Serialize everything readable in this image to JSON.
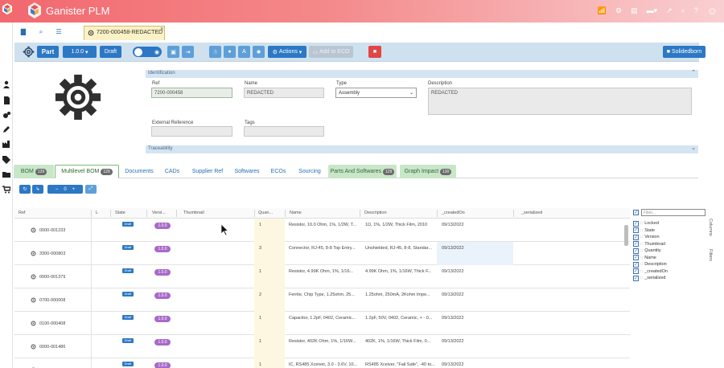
{
  "app": {
    "title": "Ganister PLM"
  },
  "tab": {
    "label": "7200-000458-REDACTED",
    "close": "x"
  },
  "toolbar": {
    "type_label": "Part",
    "version": "1.0.0",
    "status": "Draft",
    "actions_label": "Actions",
    "add_to_eco_label": "Add to ECO",
    "solidedborn_label": "Solidedborn"
  },
  "identification": {
    "title": "Identification",
    "ref_label": "Ref",
    "ref_value": "7200-000458",
    "name_label": "Name",
    "name_value": "REDACTED",
    "type_label": "Type",
    "type_value": "Assembly",
    "description_label": "Description",
    "description_value": "REDACTED",
    "external_ref_label": "External Reference",
    "tags_label": "Tags"
  },
  "traceability": {
    "title": "Traceability"
  },
  "bottom_tabs": [
    {
      "label": "BOM",
      "badge": "129"
    },
    {
      "label": "Multilevel BOM",
      "badge": "129"
    },
    {
      "label": "Documents"
    },
    {
      "label": "CADs"
    },
    {
      "label": "Supplier Ref"
    },
    {
      "label": "Softwares"
    },
    {
      "label": "ECOs"
    },
    {
      "label": "Sourcing"
    },
    {
      "label": "Parts And Softwares",
      "badge": "129"
    },
    {
      "label": "Graph Impact",
      "badge": "130"
    }
  ],
  "subtoolbar": {
    "counter": "0"
  },
  "grid": {
    "columns": [
      "Ref",
      "L",
      "State",
      "Versi...",
      "Thumbnail",
      "Quan...",
      "Name",
      "Description",
      "_createdOn",
      "_serialized"
    ],
    "rows": [
      {
        "ref": "0000-001233",
        "state": "Draft",
        "version": "1.0.0",
        "qty": "1",
        "name": "Resistor, 10.0 Ohm, 1%, 1/2W, T...",
        "description": "1Ω, 1%, 1/2W, Thick Film, 2010",
        "created": "09/13/2022"
      },
      {
        "ref": "3300-000803",
        "state": "Draft",
        "version": "1.0.0",
        "qty": "3",
        "name": "Connector, RJ-45, 8-8 Top Entry...",
        "description": "Unshielded, RJ-45, 8-8, Standar...",
        "created": "09/13/2022"
      },
      {
        "ref": "0000-001379",
        "state": "Draft",
        "version": "1.0.0",
        "qty": "1",
        "name": "Resistor, 4.99K Ohm, 1%, 1/16...",
        "description": "4.99K Ohm, 1%, 1/16W, Thick F...",
        "created": "09/13/2022"
      },
      {
        "ref": "0700-000008",
        "state": "Draft",
        "version": "1.0.0",
        "qty": "2",
        "name": "Ferrite, Chip Type, 1.25ohm, 25...",
        "description": "1.25ohm, 250mA, 2Kohm Impe...",
        "created": "09/13/2022"
      },
      {
        "ref": "0100-000408",
        "state": "Draft",
        "version": "1.0.0",
        "qty": "1",
        "name": "Capacitor, 1.2pF, 0402, Ceramic...",
        "description": "1.2pF, 50V, 0402, Ceramic, + - 0...",
        "created": "09/13/2022"
      },
      {
        "ref": "0000-001486",
        "state": "Draft",
        "version": "1.0.0",
        "qty": "1",
        "name": "Resistor, 402K Ohm, 1%, 1/16W...",
        "description": "402K, 1%, 1/16W, Thick Film, 0...",
        "created": "09/13/2022"
      },
      {
        "ref": "2300-000564",
        "state": "Draft",
        "version": "1.0.0",
        "qty": "1",
        "name": "IC, RS485 Xceiver, 3.0 - 3.6V, 10...",
        "description": "RS485 Xceiver, \"Fail Safe\", -40 to...",
        "created": "09/13/2022"
      }
    ]
  },
  "columns_panel": {
    "filter_placeholder": "Filter...",
    "items": [
      "Locked",
      "State",
      "Version",
      "Thumbnail",
      "Quantity",
      "Name",
      "Description",
      "_createdOn",
      "_serialized"
    ],
    "side_columns": "Columns",
    "side_filters": "Filters"
  },
  "colors": {
    "topbar_start": "#f2686f",
    "primary": "#2d78c4",
    "version_badge": "#a869c9",
    "danger": "#e04646"
  }
}
